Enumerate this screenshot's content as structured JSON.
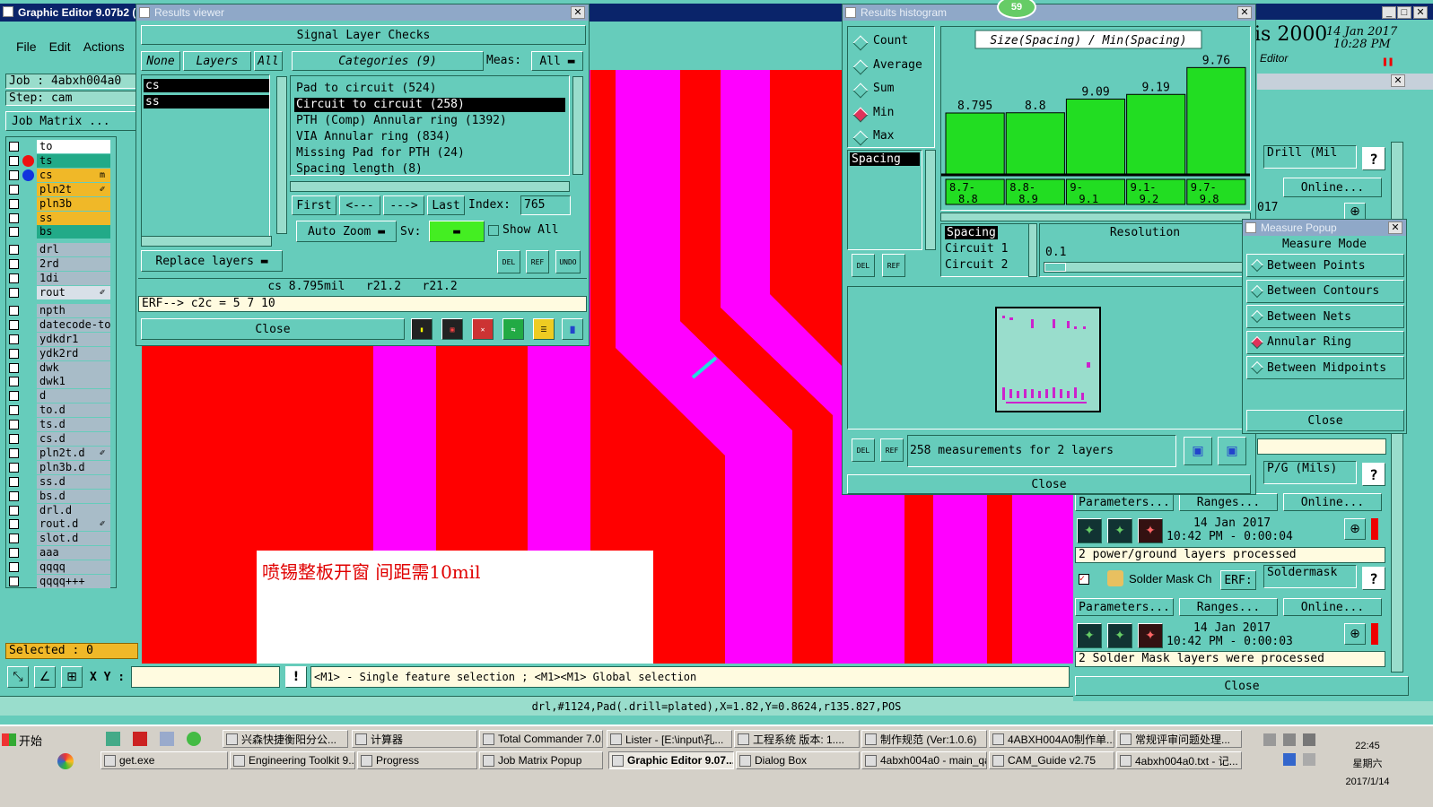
{
  "main_window": {
    "title": "Graphic Editor 9.07b2 (",
    "menu": [
      "File",
      "Edit",
      "Actions"
    ],
    "job_label": "Job : 4abxh004a0",
    "step_label": "Step: cam",
    "job_matrix_button": "Job Matrix ...",
    "selected_label": "Selected : 0",
    "xy_label": "X Y :",
    "status_hint": "<M1> - Single feature selection ; <M1><M1> Global selection",
    "feature_info": "drl,#1124,Pad(.drill=plated),X=1.82,Y=0.8624,r135.827,POS",
    "annotation_text": "喷锡整板开窗  间距需10mil",
    "right_strip_title": "is 2000",
    "right_strip_subtitle": "Editor",
    "right_date": "14 Jan 2017",
    "right_time": "10:28 PM",
    "layers": [
      {
        "name": "to",
        "color": "#ffffff",
        "dot": ""
      },
      {
        "name": "ts",
        "color": "#22aa88",
        "dot": "#ee1111"
      },
      {
        "name": "cs",
        "color": "#f0b828",
        "dot": "#1133dd",
        "mark": "m"
      },
      {
        "name": "pln2t",
        "color": "#f0b828",
        "dot": "",
        "mark": "✐"
      },
      {
        "name": "pln3b",
        "color": "#f0b828",
        "dot": ""
      },
      {
        "name": "ss",
        "color": "#f0b828",
        "dot": ""
      },
      {
        "name": "bs",
        "color": "#22aa88",
        "dot": ""
      },
      {
        "name": "drl",
        "color": "#a8bcc8",
        "dot": ""
      },
      {
        "name": "2rd",
        "color": "#a8bcc8",
        "dot": ""
      },
      {
        "name": "1di",
        "color": "#a8bcc8",
        "dot": ""
      },
      {
        "name": "rout",
        "color": "#d8e0e8",
        "dot": "",
        "mark": "✐"
      },
      {
        "name": "npth",
        "color": "#a8bcc8",
        "dot": ""
      },
      {
        "name": "datecode-to",
        "color": "#a8bcc8",
        "dot": ""
      },
      {
        "name": "ydkdr1",
        "color": "#a8bcc8",
        "dot": ""
      },
      {
        "name": "ydk2rd",
        "color": "#a8bcc8",
        "dot": ""
      },
      {
        "name": "dwk",
        "color": "#a8bcc8",
        "dot": ""
      },
      {
        "name": "dwk1",
        "color": "#a8bcc8",
        "dot": ""
      },
      {
        "name": "d",
        "color": "#a8bcc8",
        "dot": ""
      },
      {
        "name": "to.d",
        "color": "#a8bcc8",
        "dot": ""
      },
      {
        "name": "ts.d",
        "color": "#a8bcc8",
        "dot": ""
      },
      {
        "name": "cs.d",
        "color": "#a8bcc8",
        "dot": ""
      },
      {
        "name": "pln2t.d",
        "color": "#a8bcc8",
        "dot": "",
        "mark": "✐"
      },
      {
        "name": "pln3b.d",
        "color": "#a8bcc8",
        "dot": ""
      },
      {
        "name": "ss.d",
        "color": "#a8bcc8",
        "dot": ""
      },
      {
        "name": "bs.d",
        "color": "#a8bcc8",
        "dot": ""
      },
      {
        "name": "drl.d",
        "color": "#a8bcc8",
        "dot": ""
      },
      {
        "name": "rout.d",
        "color": "#a8bcc8",
        "dot": "",
        "mark": "✐"
      },
      {
        "name": "slot.d",
        "color": "#a8bcc8",
        "dot": ""
      },
      {
        "name": "aaa",
        "color": "#a8bcc8",
        "dot": ""
      },
      {
        "name": "qqqq",
        "color": "#a8bcc8",
        "dot": ""
      },
      {
        "name": "qqqq+++",
        "color": "#a8bcc8",
        "dot": ""
      }
    ]
  },
  "results_viewer": {
    "title": "Results viewer",
    "header": "Signal Layer Checks",
    "none_btn": "None",
    "layers_btn": "Layers",
    "all_btn": "All",
    "categories_btn": "Categories (9)",
    "meas_label": "Meas:",
    "meas_value": "All",
    "layer_list": [
      "cs",
      "ss"
    ],
    "categories": [
      "Pad to circuit (524)",
      "Circuit to circuit (258)",
      "PTH (Comp) Annular ring (1392)",
      "VIA Annular ring (834)",
      "Missing Pad for PTH (24)",
      "Spacing length (8)"
    ],
    "first_btn": "First",
    "prev_btn": "<---",
    "next_btn": "--->",
    "last_btn": "Last",
    "index_label": "Index:",
    "index_value": "765",
    "auto_zoom": "Auto Zoom",
    "sv_label": "Sv:",
    "show_all": "Show All",
    "replace_layers": "Replace layers",
    "del": "DEL",
    "ref": "REF",
    "undo": "UNDO",
    "info_line": "cs 8.795mil   r21.2   r21.2",
    "erf_line": "ERF--> c2c = 5 7 10",
    "close_btn": "Close"
  },
  "histogram": {
    "title": "Results histogram",
    "badge": "59",
    "stat_options": [
      "Count",
      "Average",
      "Sum",
      "Min",
      "Max"
    ],
    "selected_stat": "Min",
    "chart_title": "Size(Spacing) / Min(Spacing)",
    "list_item": "Spacing",
    "spacing_labels": [
      "Spacing",
      "Circuit 1",
      "Circuit 2"
    ],
    "resolution_label": "Resolution",
    "resolution_value": "0.1",
    "summary": "258 measurements for 2 layers",
    "close_btn": "Close",
    "del": "DEL",
    "ref": "REF"
  },
  "chart_data": {
    "type": "bar",
    "title": "Size(Spacing) / Min(Spacing)",
    "categories": [
      "8.7-8.8",
      "8.8-8.9",
      "9-9.1",
      "9.1-9.2",
      "9.7-9.8"
    ],
    "values": [
      8.795,
      8.8,
      9.09,
      9.19,
      9.76
    ],
    "value_labels": [
      "8.795",
      "8.8",
      "9.09",
      "9.19",
      "9.76"
    ],
    "bar_color": "#22dd22",
    "ylim": [
      7.5,
      9.9
    ]
  },
  "measure_popup": {
    "title": "Measure Popup",
    "header": "Measure Mode",
    "modes": [
      "Between Points",
      "Between Contours",
      "Between Nets",
      "Annular Ring",
      "Between Midpoints"
    ],
    "selected_mode": "Annular Ring",
    "close_btn": "Close"
  },
  "right_panel": {
    "drill_label": "Drill (Mil",
    "online_btn": "Online...",
    "year_fragment": "017",
    "pg_label": "P/G (Mils)",
    "parameters_btn": "Parameters...",
    "ranges_btn": "Ranges...",
    "online_btn2": "Online...",
    "date1": "14 Jan 2017",
    "time1": "10:42 PM - 0:00:04",
    "msg1": "2 power/ground layers processed",
    "solder_mask_label": "Solder Mask Ch",
    "erf_label": "ERF:",
    "soldermask_value": "Soldermask",
    "parameters_btn2": "Parameters...",
    "ranges_btn2": "Ranges...",
    "online_btn3": "Online...",
    "date2": "14 Jan 2017",
    "time2": "10:42 PM - 0:00:03",
    "msg2": "2 Solder Mask layers were processed",
    "close_btn": "Close",
    "help": "?"
  },
  "taskbar": {
    "start": "开始",
    "row1": [
      "兴森快捷衡阳分公...",
      "计算器",
      "Total Commander 7.0...",
      "Lister - [E:\\input\\孔...",
      "工程系统  版本: 1....",
      "制作规范 (Ver:1.0.6)",
      "4ABXH004A0制作单...",
      "常规评审问题处理..."
    ],
    "row2": [
      "get.exe",
      "Engineering Toolkit 9....",
      "Progress",
      "Job Matrix Popup",
      "Graphic Editor 9.07...",
      "Dialog Box",
      "4abxh004a0 - main_qa",
      "CAM_Guide v2.75",
      "4abxh004a0.txt - 记..."
    ],
    "active_task": "Graphic Editor 9.07...",
    "clock_time": "22:45",
    "clock_day": "星期六",
    "clock_date": "2017/1/14"
  }
}
